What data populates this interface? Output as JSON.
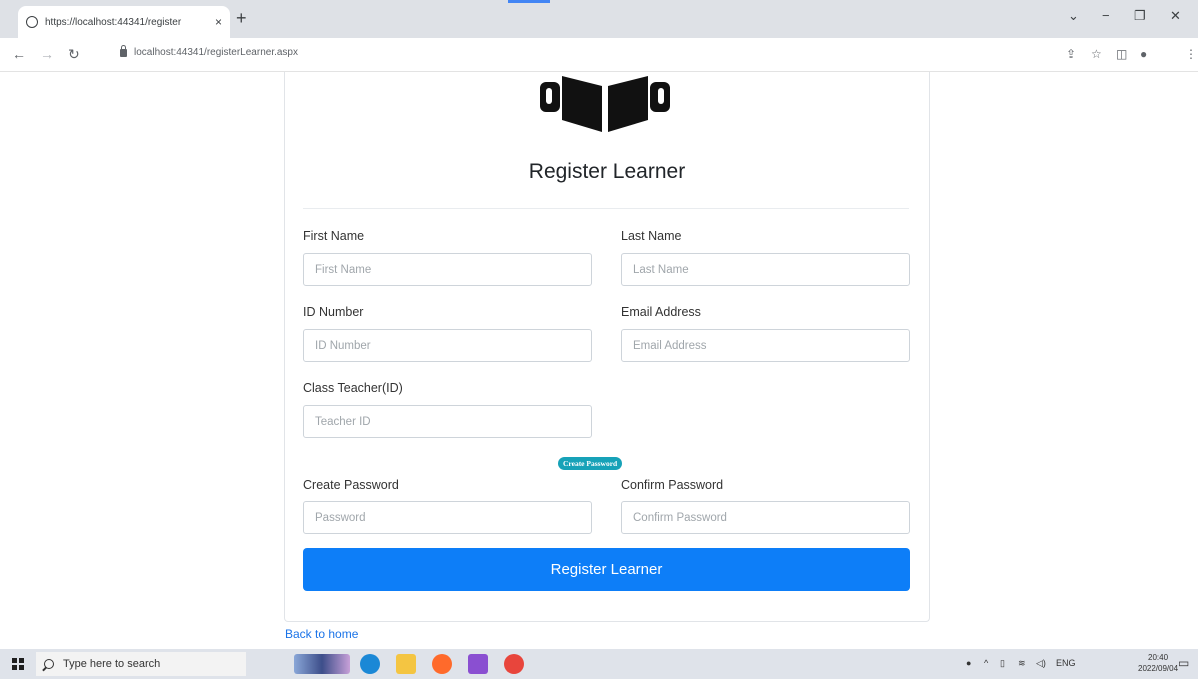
{
  "browser": {
    "tab_title": "https://localhost:44341/register",
    "tab_close": "×",
    "new_tab": "+",
    "url": "localhost:44341/registerLearner.aspx",
    "window_minimize": "−",
    "window_restore": "❐",
    "window_close": "✕",
    "tab_dropdown": "⌄"
  },
  "page": {
    "heading": "Register Learner",
    "fields": {
      "first_name": {
        "label": "First Name",
        "placeholder": "First Name"
      },
      "last_name": {
        "label": "Last Name",
        "placeholder": "Last Name"
      },
      "id_number": {
        "label": "ID Number",
        "placeholder": "ID Number"
      },
      "email": {
        "label": "Email Address",
        "placeholder": "Email Address"
      },
      "class_teacher": {
        "label": "Class Teacher(ID)",
        "placeholder": "Teacher ID"
      },
      "password": {
        "label": "Create Password",
        "placeholder": "Password"
      },
      "confirm_password": {
        "label": "Confirm Password",
        "placeholder": "Confirm Password"
      }
    },
    "badge": "Create Password",
    "submit_label": "Register Learner",
    "back_link": "Back to home"
  },
  "taskbar": {
    "search_placeholder": "Type here to search",
    "language": "ENG",
    "time": "20:40",
    "date": "2022/09/04"
  },
  "colors": {
    "primary": "#0d7ef8",
    "badge": "#17a2b8",
    "link": "#1a73e8"
  }
}
